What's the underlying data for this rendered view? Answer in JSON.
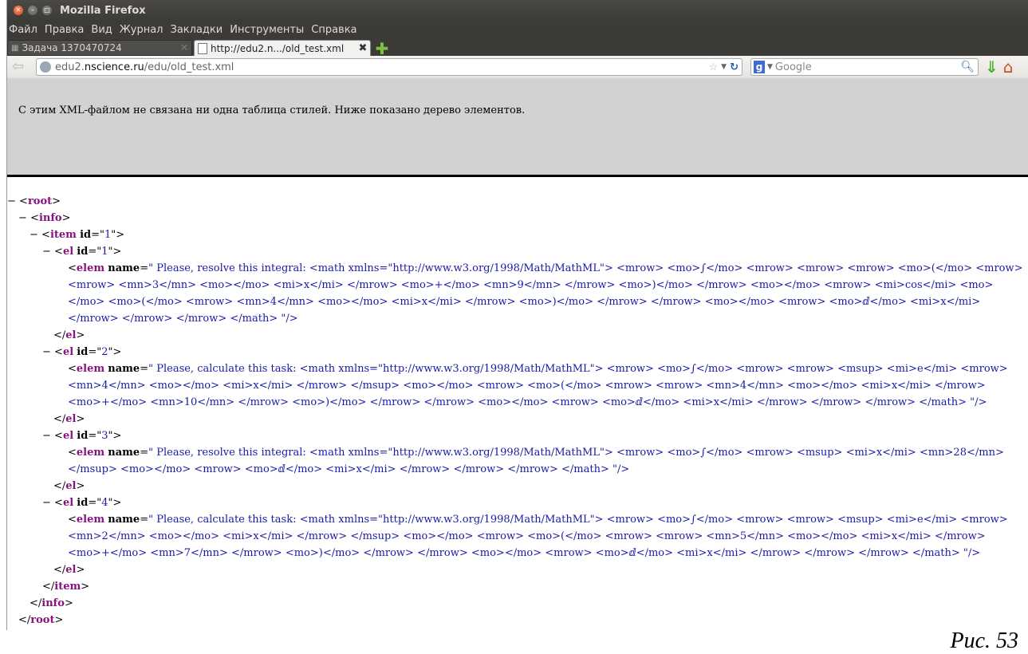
{
  "window": {
    "title": "Mozilla Firefox"
  },
  "menubar": [
    "Файл",
    "Правка",
    "Вид",
    "Журнал",
    "Закладки",
    "Инструменты",
    "Справка"
  ],
  "tabs": [
    {
      "label": "Задача 1370470724",
      "active": false
    },
    {
      "label": "http://edu2.n.../old_test.xml",
      "active": true
    }
  ],
  "nav": {
    "url_domain_prefix": "edu2.",
    "url_domain": "nscience.ru",
    "url_path": "/edu/old_test.xml",
    "search_placeholder": "Google"
  },
  "info_message": "С этим XML-файлом не связана ни одна таблица стилей. Ниже показано дерево элементов.",
  "tree": {
    "root": "root",
    "info": "info",
    "item": "item",
    "item_id": "1",
    "el_tag": "el",
    "elem_tag": "elem",
    "attr_id": "id",
    "attr_name": "name",
    "els": [
      {
        "id": "1",
        "text": "\" Please, resolve this integral: <math xmlns=\"http://www.w3.org/1998/Math/MathML\"> <mrow> <mo>∫</mo> <mrow> <mrow> <mrow> <mo>(</mo> <mrow> <mrow> <mn>3</mn> <mo></mo> <mi>x</mi> </mrow> <mo>+</mo> <mn>9</mn> </mrow> <mo>)</mo> </mrow> <mo></mo> <mrow> <mi>cos</mi> <mo></mo> <mo>(</mo> <mrow> <mn>4</mn> <mo></mo> <mi>x</mi> </mrow> <mo>)</mo> </mrow> </mrow> <mo></mo> <mrow> <mo>ⅆ</mo> <mi>x</mi> </mrow> </mrow> </mrow> </math> \"/>"
      },
      {
        "id": "2",
        "text": "\" Please, calculate this task: <math xmlns=\"http://www.w3.org/1998/Math/MathML\"> <mrow> <mo>∫</mo> <mrow> <mrow> <msup> <mi>e</mi> <mrow> <mn>4</mn> <mo></mo> <mi>x</mi> </mrow> </msup> <mo></mo> <mrow> <mo>(</mo> <mrow> <mrow> <mn>4</mn> <mo></mo> <mi>x</mi> </mrow> <mo>+</mo> <mn>10</mn> </mrow> <mo>)</mo> </mrow> </mrow> <mo></mo> <mrow> <mo>ⅆ</mo> <mi>x</mi> </mrow> </mrow> </mrow> </math> \"/>"
      },
      {
        "id": "3",
        "text": "\" Please, resolve this integral: <math xmlns=\"http://www.w3.org/1998/Math/MathML\"> <mrow> <mo>∫</mo> <mrow> <msup> <mi>x</mi> <mn>28</mn> </msup> <mo></mo> <mrow> <mo>ⅆ</mo> <mi>x</mi> </mrow> </mrow> </mrow> </math> \"/>"
      },
      {
        "id": "4",
        "text": "\" Please, calculate this task: <math xmlns=\"http://www.w3.org/1998/Math/MathML\"> <mrow> <mo>∫</mo> <mrow> <mrow> <msup> <mi>e</mi> <mrow> <mn>2</mn> <mo></mo> <mi>x</mi> </mrow> </msup> <mo></mo> <mrow> <mo>(</mo> <mrow> <mrow> <mn>5</mn> <mo></mo> <mi>x</mi> </mrow> <mo>+</mo> <mn>7</mn> </mrow> <mo>)</mo> </mrow> </mrow> <mo></mo> <mrow> <mo>ⅆ</mo> <mi>x</mi> </mrow> </mrow> </mrow> </math> \"/>"
      }
    ]
  },
  "caption": "Рис. 53"
}
